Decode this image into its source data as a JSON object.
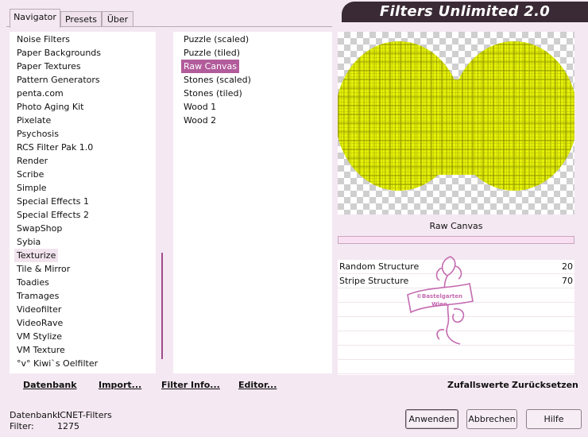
{
  "tabs": [
    {
      "label": "Navigator"
    },
    {
      "label": "Presets"
    },
    {
      "label": "Über"
    }
  ],
  "app_title": "Filters Unlimited 2.0",
  "categories": [
    "Noise Filters",
    "Paper Backgrounds",
    "Paper Textures",
    "Pattern Generators",
    "penta.com",
    "Photo Aging Kit",
    "Pixelate",
    "Psychosis",
    "RCS Filter Pak 1.0",
    "Render",
    "Scribe",
    "Simple",
    "Special Effects 1",
    "Special Effects 2",
    "SwapShop",
    "Sybia",
    "Texturize",
    "Tile & Mirror",
    "Toadies",
    "Tramages",
    "Videofilter",
    "VideoRave",
    "VM Stylize",
    "VM Texture",
    "°v° Kiwi`s Oelfilter"
  ],
  "selected_category": "Texturize",
  "filters": [
    "Puzzle (scaled)",
    "Puzzle (tiled)",
    "Raw Canvas",
    "Stones (scaled)",
    "Stones (tiled)",
    "Wood 1",
    "Wood 2"
  ],
  "selected_filter": "Raw Canvas",
  "preview": {
    "filter_name": "Raw Canvas",
    "colors": {
      "fill": "#e6f20a",
      "line": "#9aa000",
      "checker": "#cfcfcf"
    }
  },
  "params": [
    {
      "label": "Random Structure",
      "value": "20"
    },
    {
      "label": "Stripe Structure",
      "value": "70"
    }
  ],
  "watermark": {
    "line1": "©Bastelgarten",
    "line2": "Wien"
  },
  "left_buttons": {
    "database": "Datenbank",
    "import": "Import...",
    "filter_info": "Filter Info...",
    "editor": "Editor..."
  },
  "right_buttons": {
    "random": "Zufallswerte",
    "reset": "Zurücksetzen"
  },
  "status": {
    "database_label": "Datenbank:",
    "database_value": "ICNET-Filters",
    "filter_label": "Filter:",
    "filter_value": "1275"
  },
  "dialog_buttons": {
    "apply": "Anwenden",
    "cancel": "Abbrechen",
    "help": "Hilfe"
  },
  "colors": {
    "accent": "#b25c9c",
    "banner": "#3a2a35",
    "background": "#f4e8f2"
  }
}
